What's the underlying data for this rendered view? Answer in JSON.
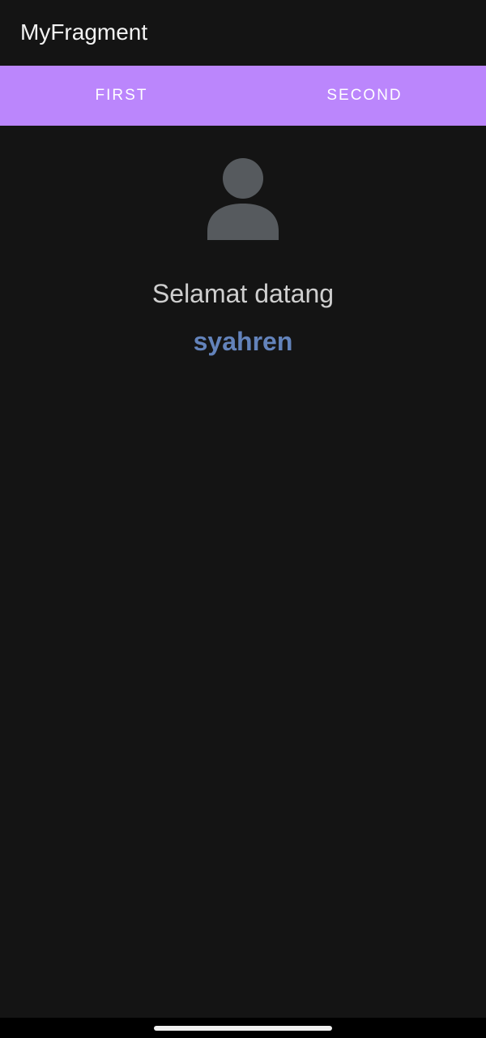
{
  "app_bar": {
    "title": "MyFragment"
  },
  "tabs": [
    {
      "label": "FIRST"
    },
    {
      "label": "SECOND"
    }
  ],
  "profile": {
    "avatar_icon": "person-icon",
    "greeting": "Selamat datang",
    "username": "syahren"
  },
  "colors": {
    "tab_bar_bg": "#bb86fc",
    "background": "#141414",
    "avatar": "#565a5e",
    "username": "#6383bb"
  }
}
